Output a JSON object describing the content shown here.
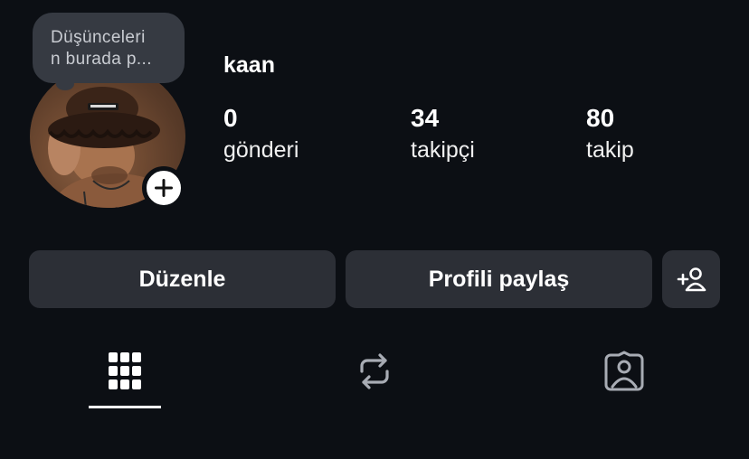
{
  "profile": {
    "username": "kaan",
    "note_line1": "Düşünceleri",
    "note_line2": "n burada p..."
  },
  "stats": {
    "posts": {
      "count": "0",
      "label": "gönderi"
    },
    "followers": {
      "count": "34",
      "label": "takipçi"
    },
    "following": {
      "count": "80",
      "label": "takip"
    }
  },
  "actions": {
    "edit_label": "Düzenle",
    "share_label": "Profili paylaş"
  },
  "icons": {
    "add_story": "plus-icon",
    "discover_people": "add-person-icon",
    "tab_posts": "grid-icon",
    "tab_reposts": "repost-icon",
    "tab_tagged": "tagged-person-icon"
  },
  "colors": {
    "background": "#0c0f14",
    "button": "#2c2f36",
    "bubble": "#363a42",
    "text": "#ffffff",
    "inactive_icon": "#a8acb4"
  },
  "tabs": {
    "active": "posts"
  }
}
